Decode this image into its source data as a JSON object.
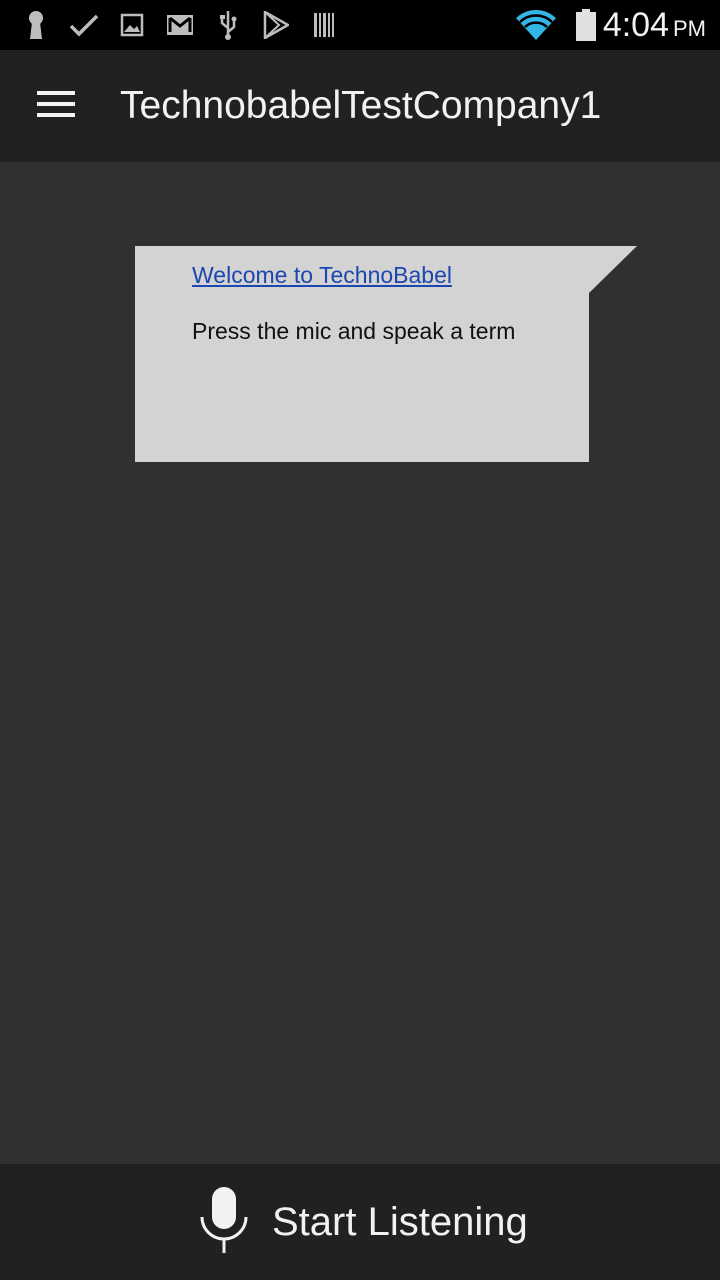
{
  "status_bar": {
    "time": "4:04",
    "ampm": "PM",
    "icons": [
      "keyhole-icon",
      "check-icon",
      "image-icon",
      "gmail-icon",
      "usb-icon",
      "play-store-icon",
      "barcode-icon",
      "wifi-icon",
      "battery-icon"
    ],
    "wifi_color": "#33b5e5"
  },
  "app_bar": {
    "title": "TechnobabelTestCompany1"
  },
  "message": {
    "link_text": "Welcome to TechnoBabel",
    "body_text": "Press the mic and speak a term",
    "link_color": "#1c46b0",
    "card_color": "#d3d3d3"
  },
  "bottom_bar": {
    "button_label": "Start Listening"
  }
}
